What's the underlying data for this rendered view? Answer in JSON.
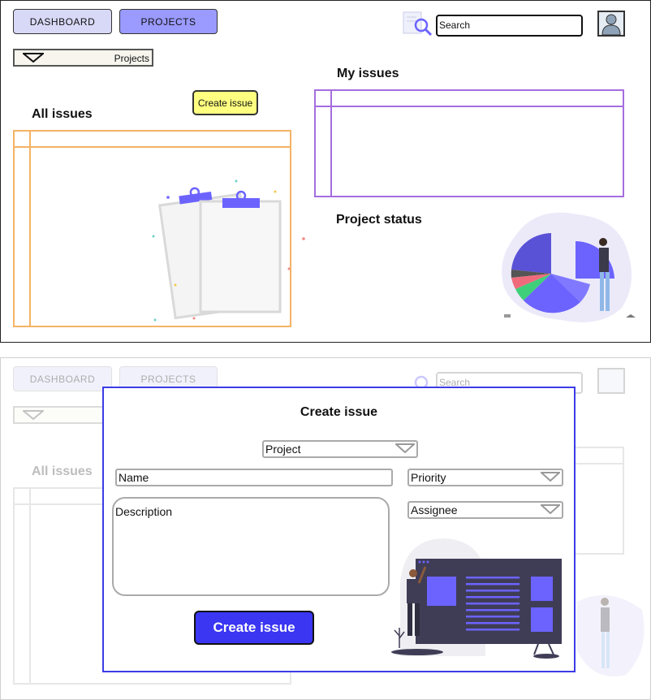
{
  "nav": {
    "dashboard_label": "DASHBOARD",
    "projects_label": "PROJECTS"
  },
  "search": {
    "placeholder": "Search"
  },
  "project_selector": {
    "label": "Projects"
  },
  "sections": {
    "all_issues": "All issues",
    "my_issues": "My issues",
    "project_status": "Project status"
  },
  "create_issue_button": "Create issue",
  "modal": {
    "title": "Create issue",
    "project_placeholder": "Project",
    "name_placeholder": "Name",
    "priority_placeholder": "Priority",
    "assignee_placeholder": "Assignee",
    "description_placeholder": "Description",
    "submit_label": "Create issue"
  },
  "colors": {
    "accent": "#3a36f2",
    "projects_button": "#9a9aff",
    "dashboard_button": "#d8d8f7",
    "all_issues_table": "#f5b366",
    "my_issues_table": "#a56ee0",
    "create_small_button": "#ffff80"
  }
}
